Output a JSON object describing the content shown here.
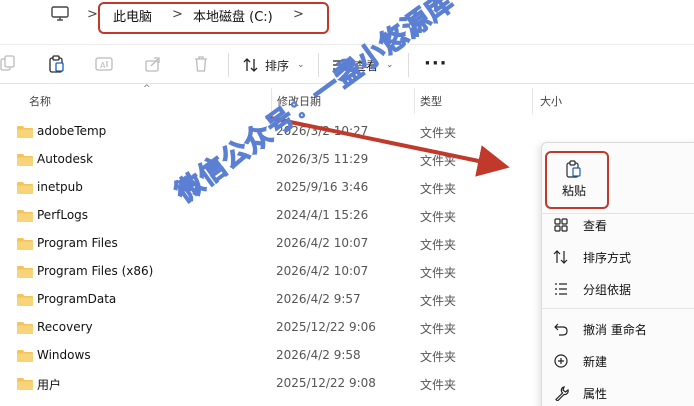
{
  "address": {
    "crumbs": [
      "此电脑",
      "本地磁盘 (C:)"
    ]
  },
  "toolbar": {
    "sort_label": "排序",
    "view_label": "查看"
  },
  "columns": {
    "name": "名称",
    "modified": "修改日期",
    "type": "类型",
    "size": "大小"
  },
  "files": [
    {
      "name": "adobeTemp",
      "modified": "2026/3/2 10:27",
      "type": "文件夹"
    },
    {
      "name": "Autodesk",
      "modified": "2026/3/5 11:29",
      "type": "文件夹"
    },
    {
      "name": "inetpub",
      "modified": "2025/9/16 3:46",
      "type": "文件夹"
    },
    {
      "name": "PerfLogs",
      "modified": "2024/4/1 15:26",
      "type": "文件夹"
    },
    {
      "name": "Program Files",
      "modified": "2026/4/2 10:07",
      "type": "文件夹"
    },
    {
      "name": "Program Files (x86)",
      "modified": "2026/4/2 10:07",
      "type": "文件夹"
    },
    {
      "name": "ProgramData",
      "modified": "2026/4/2 9:57",
      "type": "文件夹"
    },
    {
      "name": "Recovery",
      "modified": "2025/12/22 9:06",
      "type": "文件夹"
    },
    {
      "name": "Windows",
      "modified": "2026/4/2 9:58",
      "type": "文件夹"
    },
    {
      "name": "用户",
      "modified": "2025/12/22 9:08",
      "type": "文件夹"
    }
  ],
  "context_menu": {
    "paste": "粘贴",
    "items": [
      {
        "label": "查看",
        "icon": "grid-icon"
      },
      {
        "label": "排序方式",
        "icon": "sort-icon"
      },
      {
        "label": "分组依据",
        "icon": "group-icon"
      },
      {
        "label": "撤消 重命名",
        "icon": "undo-icon"
      },
      {
        "label": "新建",
        "icon": "new-icon"
      },
      {
        "label": "属性",
        "icon": "properties-icon"
      }
    ]
  },
  "watermark": "微信公众号：一盏小悠源库",
  "colors": {
    "highlight": "#c0392b",
    "folder": "#f3c45a",
    "accent": "#1a5fb4",
    "watermark_stroke": "#5b7fd3"
  }
}
